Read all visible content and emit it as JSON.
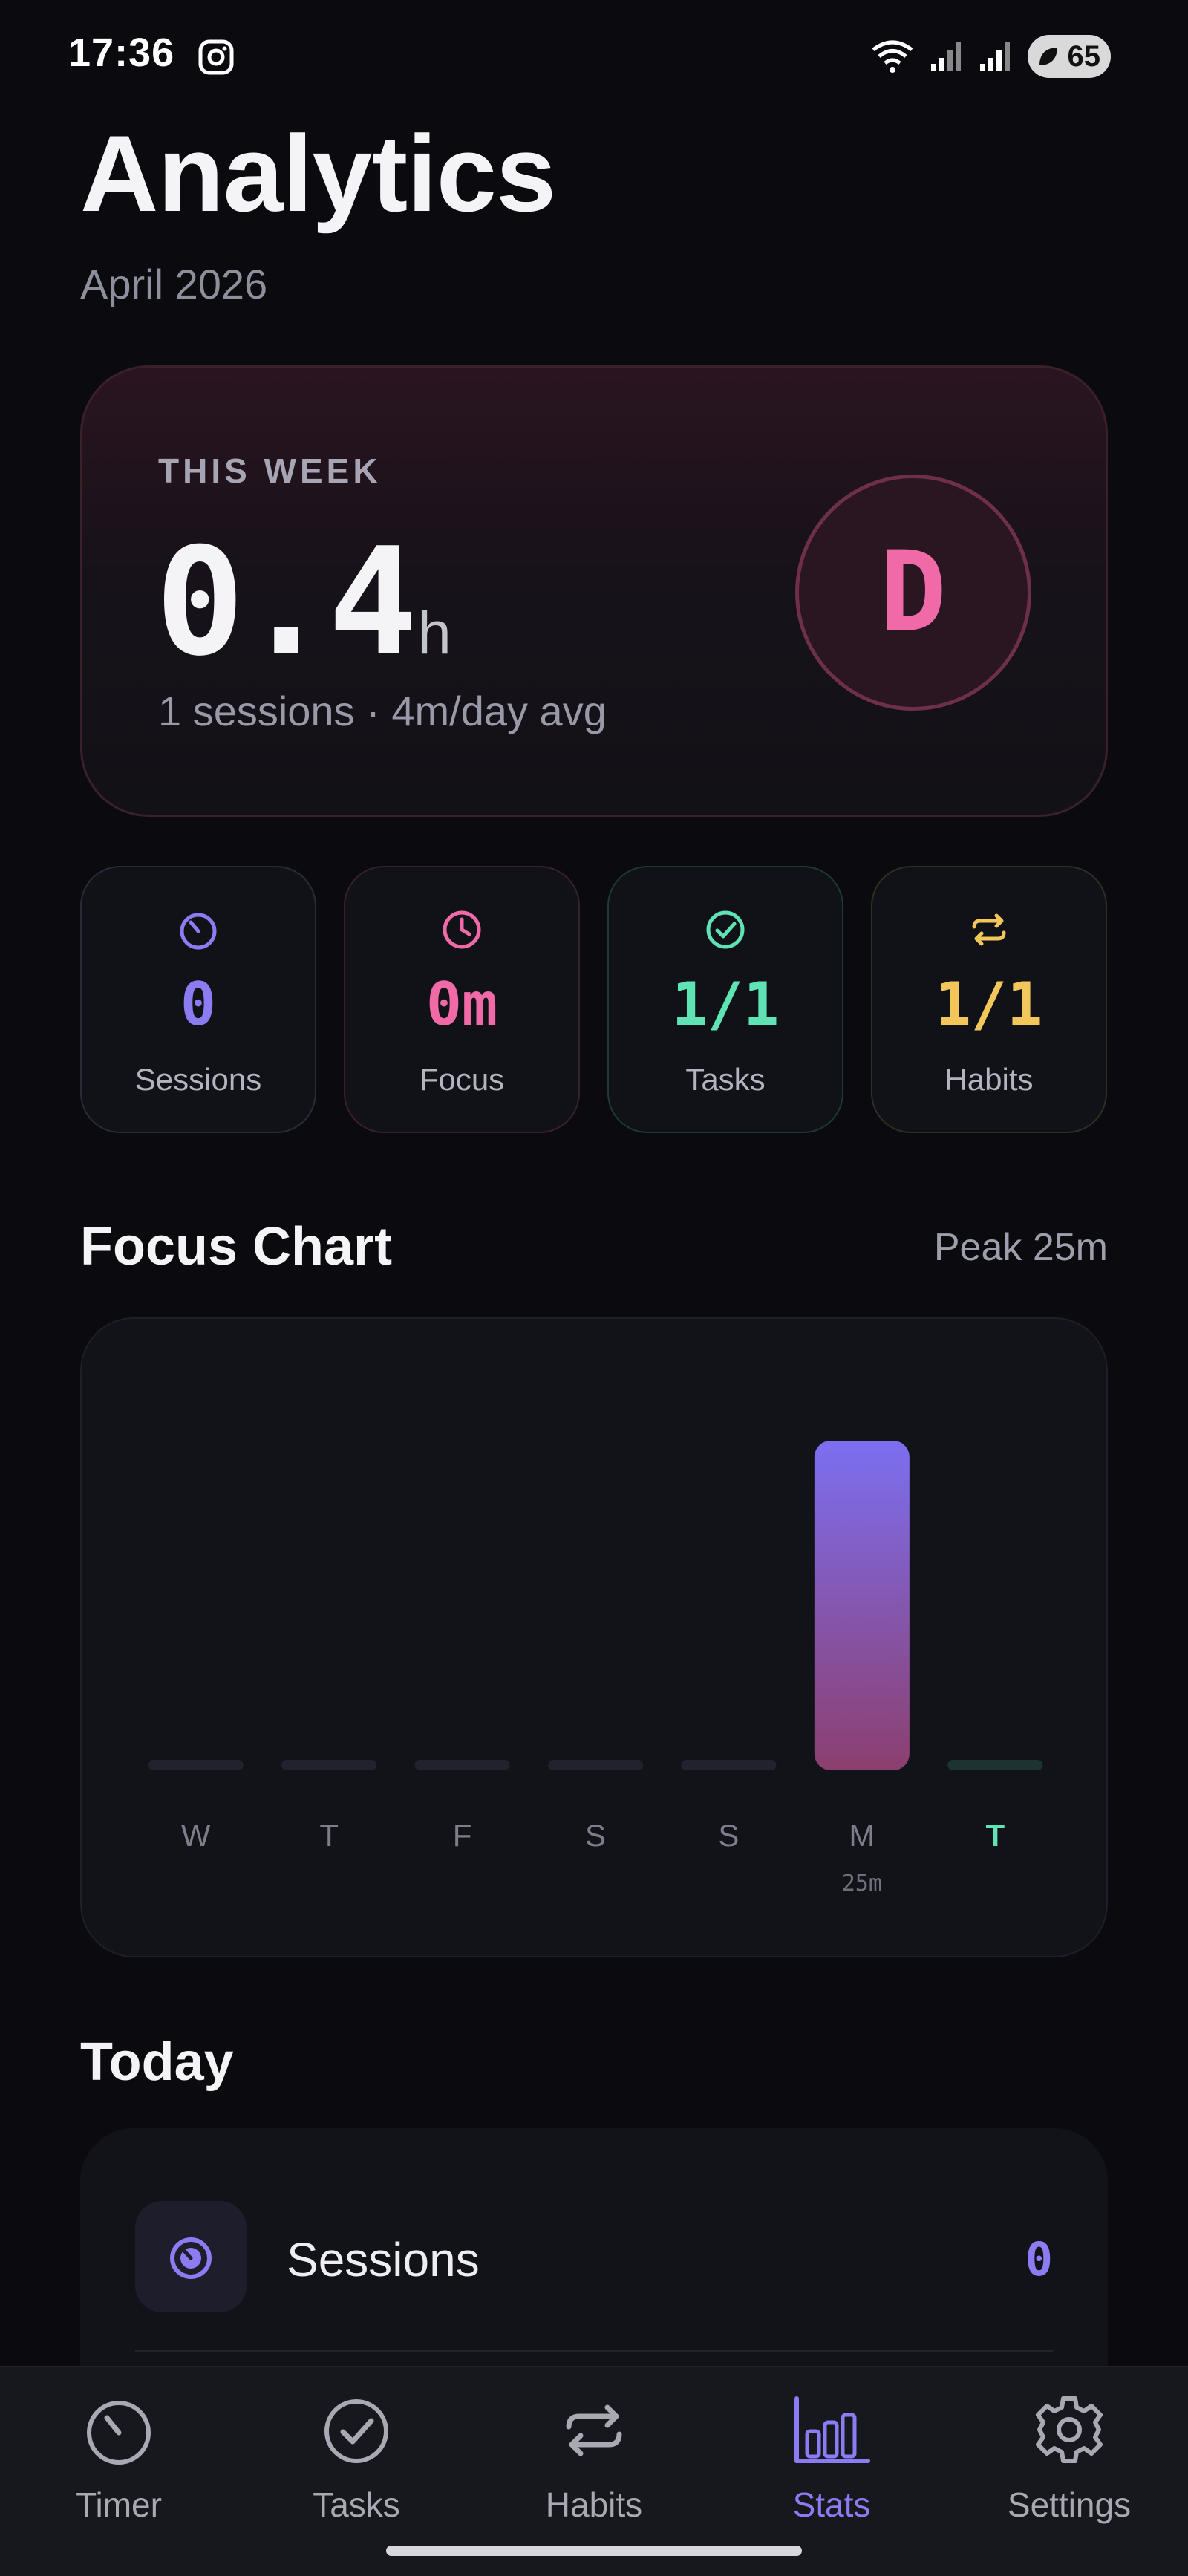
{
  "status_bar": {
    "time": "17:36",
    "battery": "65"
  },
  "header": {
    "title": "Analytics",
    "subtitle": "April 2026"
  },
  "week_card": {
    "label": "THIS WEEK",
    "hours": "0.4",
    "unit": "h",
    "summary": "1 sessions · 4m/day avg",
    "grade": "D"
  },
  "stats": [
    {
      "value": "0",
      "label": "Sessions",
      "color": "#8b7cf2",
      "icon": "timer-icon"
    },
    {
      "value": "0m",
      "label": "Focus",
      "color": "#f06aa7",
      "icon": "clock-icon"
    },
    {
      "value": "1/1",
      "label": "Tasks",
      "color": "#5fe3b4",
      "icon": "check-circle-icon"
    },
    {
      "value": "1/1",
      "label": "Habits",
      "color": "#f2c65a",
      "icon": "repeat-icon"
    }
  ],
  "focus_chart": {
    "title": "Focus Chart",
    "peak": "Peak 25m"
  },
  "chart_data": {
    "type": "bar",
    "categories": [
      "W",
      "T",
      "F",
      "S",
      "S",
      "M",
      "T"
    ],
    "values": [
      0,
      0,
      0,
      0,
      0,
      25,
      0
    ],
    "value_labels": [
      "",
      "",
      "",
      "",
      "",
      "25m",
      ""
    ],
    "highlight_index": 6,
    "ylim": [
      0,
      25
    ],
    "unit": "m",
    "grid": false
  },
  "today": {
    "title": "Today",
    "rows": [
      {
        "label": "Sessions",
        "value": "0",
        "icon": "timer-icon"
      }
    ]
  },
  "nav": {
    "items": [
      {
        "label": "Timer",
        "icon": "timer-icon",
        "active": false
      },
      {
        "label": "Tasks",
        "icon": "check-circle-icon",
        "active": false
      },
      {
        "label": "Habits",
        "icon": "repeat-icon",
        "active": false
      },
      {
        "label": "Stats",
        "icon": "bar-chart-icon",
        "active": true
      },
      {
        "label": "Settings",
        "icon": "gear-icon",
        "active": false
      }
    ]
  },
  "colors": {
    "accent": "#8a7cf3",
    "pink": "#f06aa7",
    "green": "#5fe3b4",
    "yellow": "#f2c65a"
  }
}
